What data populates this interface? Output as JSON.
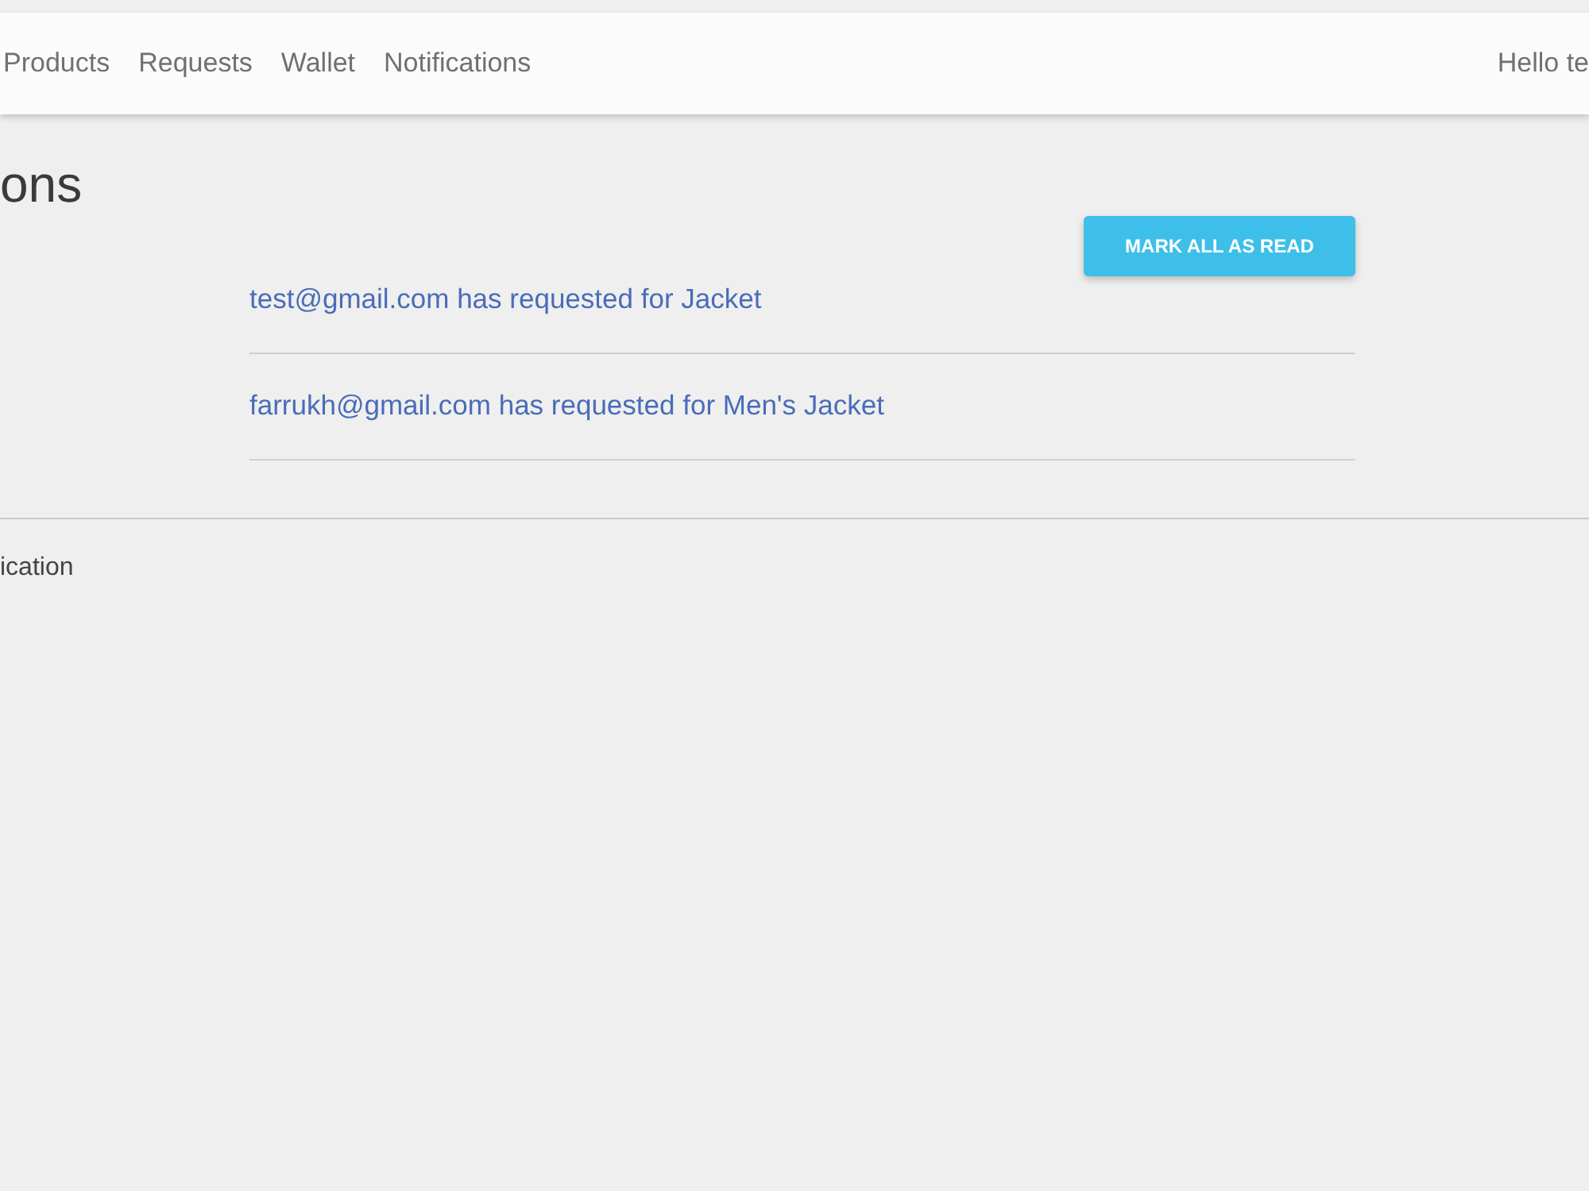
{
  "nav": {
    "links": [
      {
        "label": "Products"
      },
      {
        "label": "Requests"
      },
      {
        "label": "Wallet"
      },
      {
        "label": "Notifications"
      }
    ],
    "greeting": "Hello te"
  },
  "page": {
    "title": "ons",
    "mark_all_button": "MARK ALL AS READ",
    "notifications": [
      {
        "text": "test@gmail.com has requested for Jacket"
      },
      {
        "text": "farrukh@gmail.com has requested for Men's Jacket"
      }
    ],
    "footer_text": "ication"
  }
}
